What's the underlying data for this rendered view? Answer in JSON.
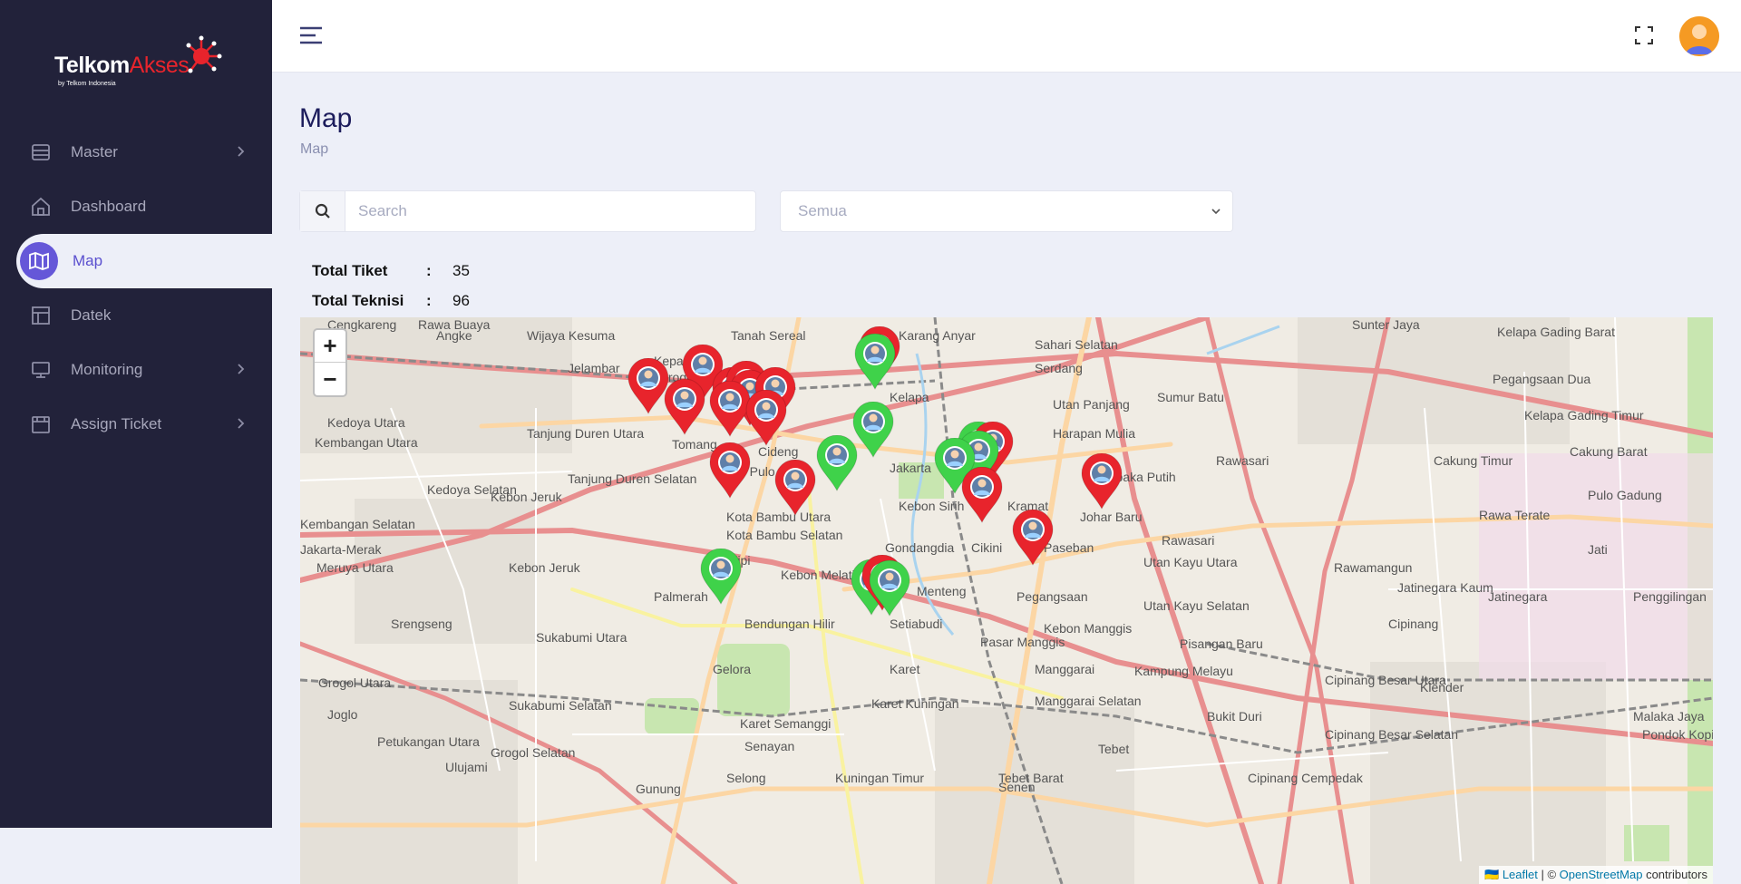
{
  "brand": {
    "name_part1": "Telkom",
    "name_part2": "Akses",
    "sub": "by Telkom Indonesia"
  },
  "sidebar": {
    "items": [
      {
        "label": "Master",
        "icon": "database-icon",
        "has_children": true
      },
      {
        "label": "Dashboard",
        "icon": "home-icon",
        "has_children": false
      },
      {
        "label": "Map",
        "icon": "map-icon",
        "has_children": false,
        "active": true
      },
      {
        "label": "Datek",
        "icon": "layout-icon",
        "has_children": false
      },
      {
        "label": "Monitoring",
        "icon": "monitor-icon",
        "has_children": true
      },
      {
        "label": "Assign Ticket",
        "icon": "ticket-icon",
        "has_children": true
      }
    ]
  },
  "header": {
    "menu_icon": "hamburger-icon",
    "fullscreen_icon": "fullscreen-icon",
    "avatar": "user-avatar"
  },
  "page": {
    "title": "Map",
    "breadcrumb": "Map"
  },
  "filters": {
    "search_placeholder": "Search",
    "status_selected": "Semua"
  },
  "stats": {
    "total_tiket_label": "Total Tiket",
    "total_tiket_value": "35",
    "total_teknisi_label": "Total Teknisi",
    "total_teknisi_value": "96"
  },
  "map": {
    "zoom_in": "+",
    "zoom_out": "−",
    "attribution_leaflet": "Leaflet",
    "attribution_sep": " | © ",
    "attribution_osm": "OpenStreetMap",
    "attribution_tail": " contributors",
    "place_labels": [
      "Cengkareng",
      "Rawa Buaya",
      "Angke",
      "Wijaya Kesuma",
      "Tanah Sereal",
      "Karang Anyar",
      "Sahari Selatan",
      "Sunter Jaya",
      "Kelapa Gading Barat",
      "Jelambar",
      "Grogol",
      "Kelapa",
      "Serdang",
      "Sumur Batu",
      "Pegangsaan Dua",
      "Kedoya Utara",
      "Tanjung Duren Utara",
      "Tomang",
      "Utan Panjang",
      "Harapan Mulia",
      "Kelapa Gading Timur",
      "Kembangan Utara",
      "Cideng",
      "Jakarta",
      "Cakung Barat",
      "Jati Pulo",
      "Tanjung Duren Selatan",
      "Cempaka Putih",
      "Kramat",
      "Kedoya Selatan",
      "Rawasari",
      "Pulo Gadung",
      "Kota Bambu Utara",
      "Kebon Sirih",
      "Johar Baru",
      "Rawa Terate",
      "Kembangan Selatan",
      "Kota Bambu Selatan",
      "Gondangdia",
      "Cikini",
      "Paseban",
      "Rawasari",
      "Jati",
      "Meruya Utara",
      "Kebon Jeruk",
      "Slipi",
      "Kebon Melati",
      "Utan Kayu Utara",
      "Rawamangun",
      "Palmerah",
      "Menteng",
      "Pegangsaan",
      "Utan Kayu Selatan",
      "Jatinegara Kaum",
      "Jatinegara",
      "Penggilingan",
      "Srengseng",
      "Sukabumi Utara",
      "Bendungan Hilir",
      "Setiabudi",
      "Kebon Manggis",
      "Pisangan Baru",
      "Cipinang",
      "Pasar Manggis",
      "Gelora",
      "Karet",
      "Manggarai",
      "Grogol Utara",
      "Kampung Melayu",
      "Cipinang Besar Utara",
      "Klender",
      "Joglo",
      "Sukabumi Selatan",
      "Karet Kuningan",
      "Manggarai Selatan",
      "Malaka Jaya",
      "Karet Semanggi",
      "Senayan",
      "Bukit Duri",
      "Pondok Kopi",
      "Petukangan Utara",
      "Grogol Selatan",
      "Tebet",
      "Cipinang Besar Selatan",
      "Ulujami",
      "Selong",
      "Kuningan Timur",
      "Tebet Barat",
      "Cipinang Cempedak",
      "Gunung",
      "Senen",
      "Cakung Timur",
      "Kebon Jeruk",
      "Kepa Duri",
      "Jakarta-Merak"
    ],
    "markers": {
      "ticket_color": "#e8242c",
      "technician_color": "#3fd24a"
    }
  }
}
